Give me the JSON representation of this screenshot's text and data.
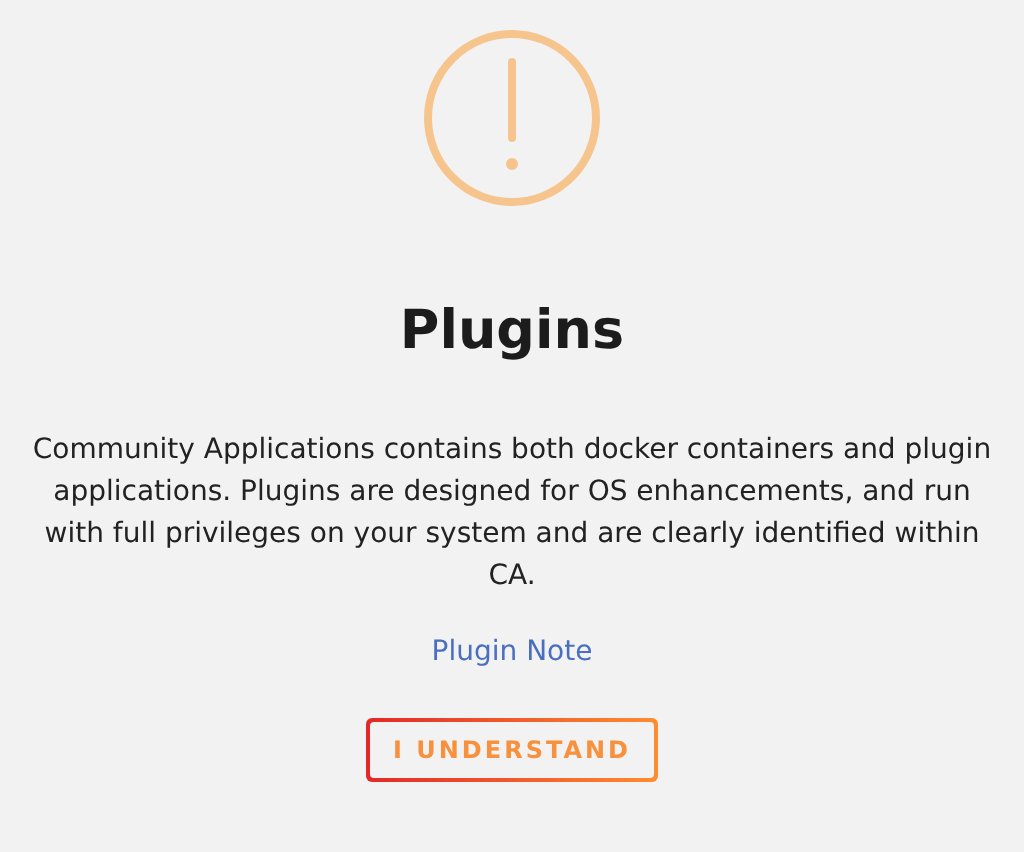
{
  "dialog": {
    "title": "Plugins",
    "message": "Community Applications contains both docker containers and plugin applications. Plugins are designed for OS enhancements, and run with full privileges on your system and are clearly identified within CA.",
    "link": "Plugin Note",
    "button": "I UNDERSTAND"
  }
}
